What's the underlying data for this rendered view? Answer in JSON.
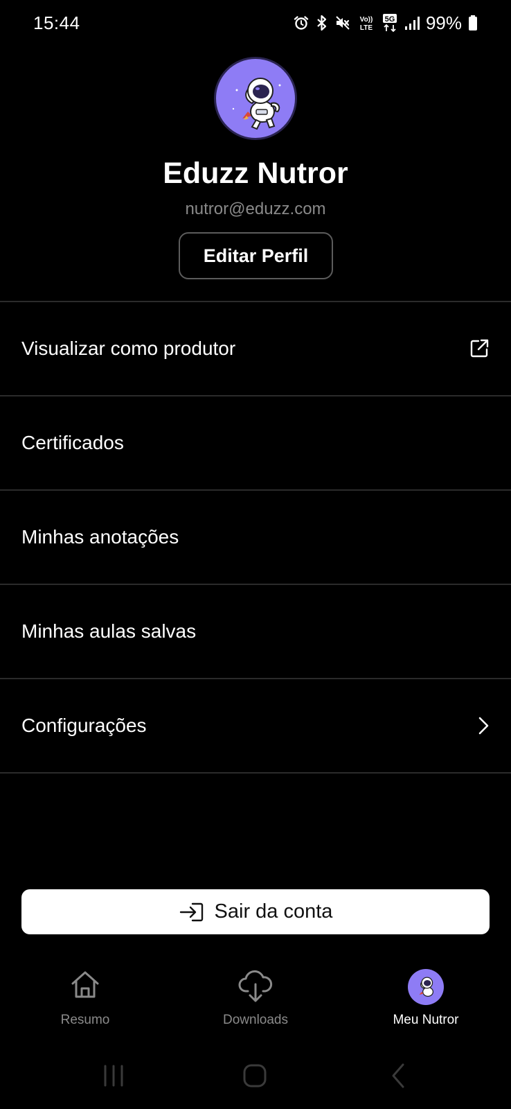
{
  "status_bar": {
    "time": "15:44",
    "battery": "99%",
    "icons": [
      "alarm-icon",
      "bluetooth-icon",
      "mute-icon",
      "volte-icon",
      "5g-icon",
      "signal-icon",
      "battery-icon"
    ],
    "volte_top": "Vo))",
    "volte_bottom": "LTE",
    "network": "5G"
  },
  "profile": {
    "name": "Eduzz Nutror",
    "email": "nutror@eduzz.com",
    "edit_label": "Editar Perfil",
    "avatar_bg": "#8e7cf5"
  },
  "menu": {
    "items": [
      {
        "label": "Visualizar como produtor",
        "icon": "external-link-icon"
      },
      {
        "label": "Certificados",
        "icon": ""
      },
      {
        "label": "Minhas anotações",
        "icon": ""
      },
      {
        "label": "Minhas aulas salvas",
        "icon": ""
      },
      {
        "label": "Configurações",
        "icon": "chevron-right-icon"
      }
    ]
  },
  "logout": {
    "label": "Sair da conta",
    "icon": "logout-icon"
  },
  "bottom_nav": {
    "items": [
      {
        "label": "Resumo",
        "icon": "home-icon",
        "active": false
      },
      {
        "label": "Downloads",
        "icon": "cloud-download-icon",
        "active": false
      },
      {
        "label": "Meu Nutror",
        "icon": "avatar",
        "active": true
      }
    ]
  },
  "system_nav": {
    "buttons": [
      "recent-apps-icon",
      "home-button-icon",
      "back-icon"
    ]
  },
  "colors": {
    "background": "#000000",
    "text": "#ffffff",
    "muted": "#8a8a8a",
    "divider": "#2b2b2b",
    "accent": "#8e7cf5"
  }
}
